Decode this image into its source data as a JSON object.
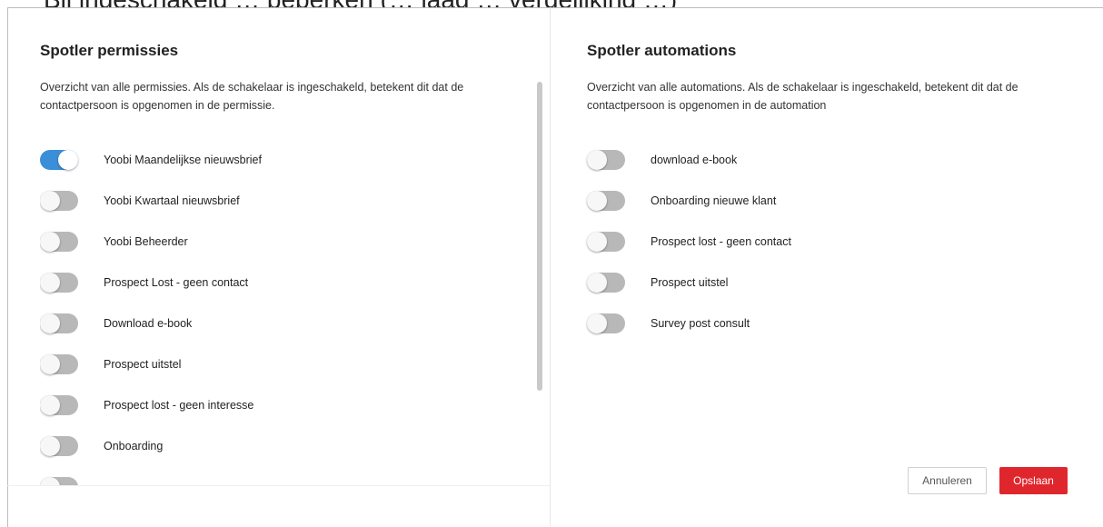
{
  "backdrop": {
    "text": "Bij ingeschakeld … beperken (… laag … vergelijking …)"
  },
  "permissions": {
    "title": "Spotler permissies",
    "description": "Overzicht van alle permissies. Als de schakelaar is ingeschakeld, betekent dit dat de contactpersoon is opgenomen in de permissie.",
    "items": [
      {
        "label": "Yoobi Maandelijkse nieuwsbrief",
        "enabled": true
      },
      {
        "label": "Yoobi Kwartaal nieuwsbrief",
        "enabled": false
      },
      {
        "label": "Yoobi Beheerder",
        "enabled": false
      },
      {
        "label": "Prospect Lost - geen contact",
        "enabled": false
      },
      {
        "label": "Download e-book",
        "enabled": false
      },
      {
        "label": "Prospect uitstel",
        "enabled": false
      },
      {
        "label": "Prospect lost - geen interesse",
        "enabled": false
      },
      {
        "label": "Onboarding",
        "enabled": false
      },
      {
        "label": "",
        "enabled": false
      }
    ]
  },
  "automations": {
    "title": "Spotler automations",
    "description": "Overzicht van alle automations. Als de schakelaar is ingeschakeld, betekent dit dat de contactpersoon is opgenomen in de automation",
    "items": [
      {
        "label": "download e-book",
        "enabled": false
      },
      {
        "label": "Onboarding nieuwe klant",
        "enabled": false
      },
      {
        "label": "Prospect lost - geen contact",
        "enabled": false
      },
      {
        "label": "Prospect uitstel",
        "enabled": false
      },
      {
        "label": "Survey post consult",
        "enabled": false
      }
    ]
  },
  "footer": {
    "cancel_label": "Annuleren",
    "save_label": "Opslaan"
  },
  "colors": {
    "toggle_on": "#3a8fd8",
    "toggle_off": "#b8b8b8",
    "save_button": "#e0262d"
  }
}
